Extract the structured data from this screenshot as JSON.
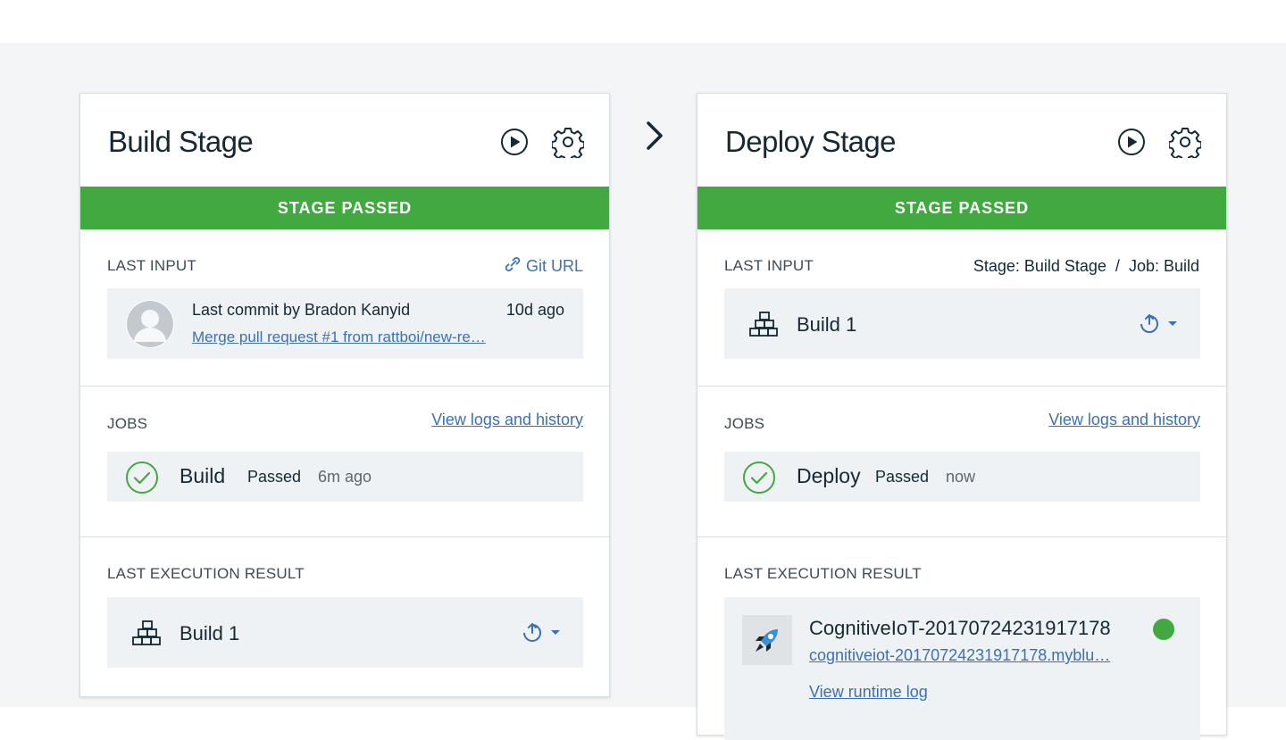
{
  "stages": [
    {
      "title": "Build Stage",
      "status": "STAGE PASSED",
      "last_input": {
        "label": "LAST INPUT",
        "link": "Git URL",
        "commit_by": "Last commit by Bradon Kanyid",
        "time": "10d ago",
        "message": "Merge pull request #1 from rattboi/new-re…"
      },
      "jobs": {
        "label": "JOBS",
        "link": "View logs and history",
        "job_name": "Build",
        "job_status": "Passed",
        "job_time": "6m ago"
      },
      "last_execution": {
        "label": "LAST EXECUTION RESULT",
        "build": "Build 1"
      }
    },
    {
      "title": "Deploy Stage",
      "status": "STAGE PASSED",
      "last_input": {
        "label": "LAST INPUT",
        "source": "Stage: Build Stage  /  Job: Build",
        "build": "Build 1"
      },
      "jobs": {
        "label": "JOBS",
        "link": "View logs and history",
        "job_name": "Deploy",
        "job_status": "Passed",
        "job_time": "now"
      },
      "last_execution": {
        "label": "LAST EXECUTION RESULT",
        "app_name": "CognitiveIoT-20170724231917178",
        "app_url": "cognitiveiot-20170724231917178.myblu…",
        "runtime_log": "View runtime log"
      }
    }
  ],
  "colors": {
    "passed": "#41a940",
    "link": "#3d70b2",
    "running_dot": "#41a940"
  },
  "icons": [
    "play-icon",
    "gear-icon",
    "link-icon",
    "avatar",
    "build-icon",
    "redeploy-icon",
    "chevron-down-icon",
    "check-circle-icon",
    "rocket-icon",
    "chevron-right-icon"
  ]
}
